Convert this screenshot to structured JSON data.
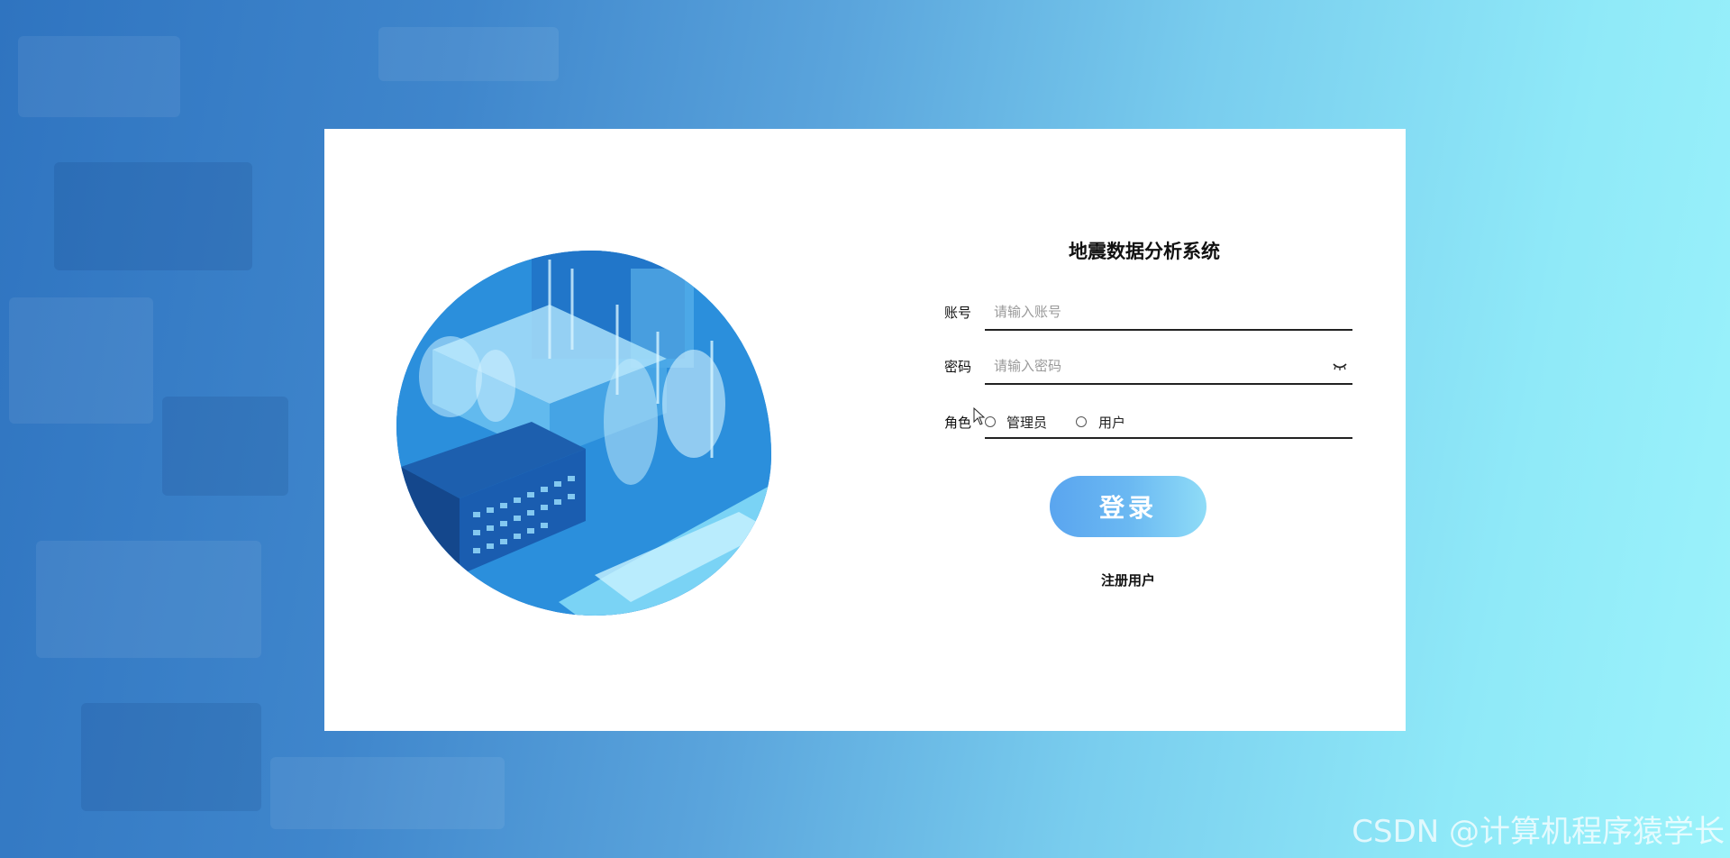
{
  "app": {
    "title": "地震数据分析系统"
  },
  "form": {
    "account_label": "账号",
    "account_placeholder": "请输入账号",
    "password_label": "密码",
    "password_placeholder": "请输入密码",
    "role_label": "角色",
    "role_options": [
      "管理员",
      "用户"
    ],
    "login_label": "登录",
    "register_label": "注册用户"
  },
  "watermark": "CSDN @计算机程序猿学长",
  "icons": {
    "password_toggle": "eye-closed-icon",
    "illustration": "factory-illustration"
  },
  "colors": {
    "accent": "#5aa5ef",
    "accent_light": "#8fdcf7",
    "underline": "#222222"
  }
}
